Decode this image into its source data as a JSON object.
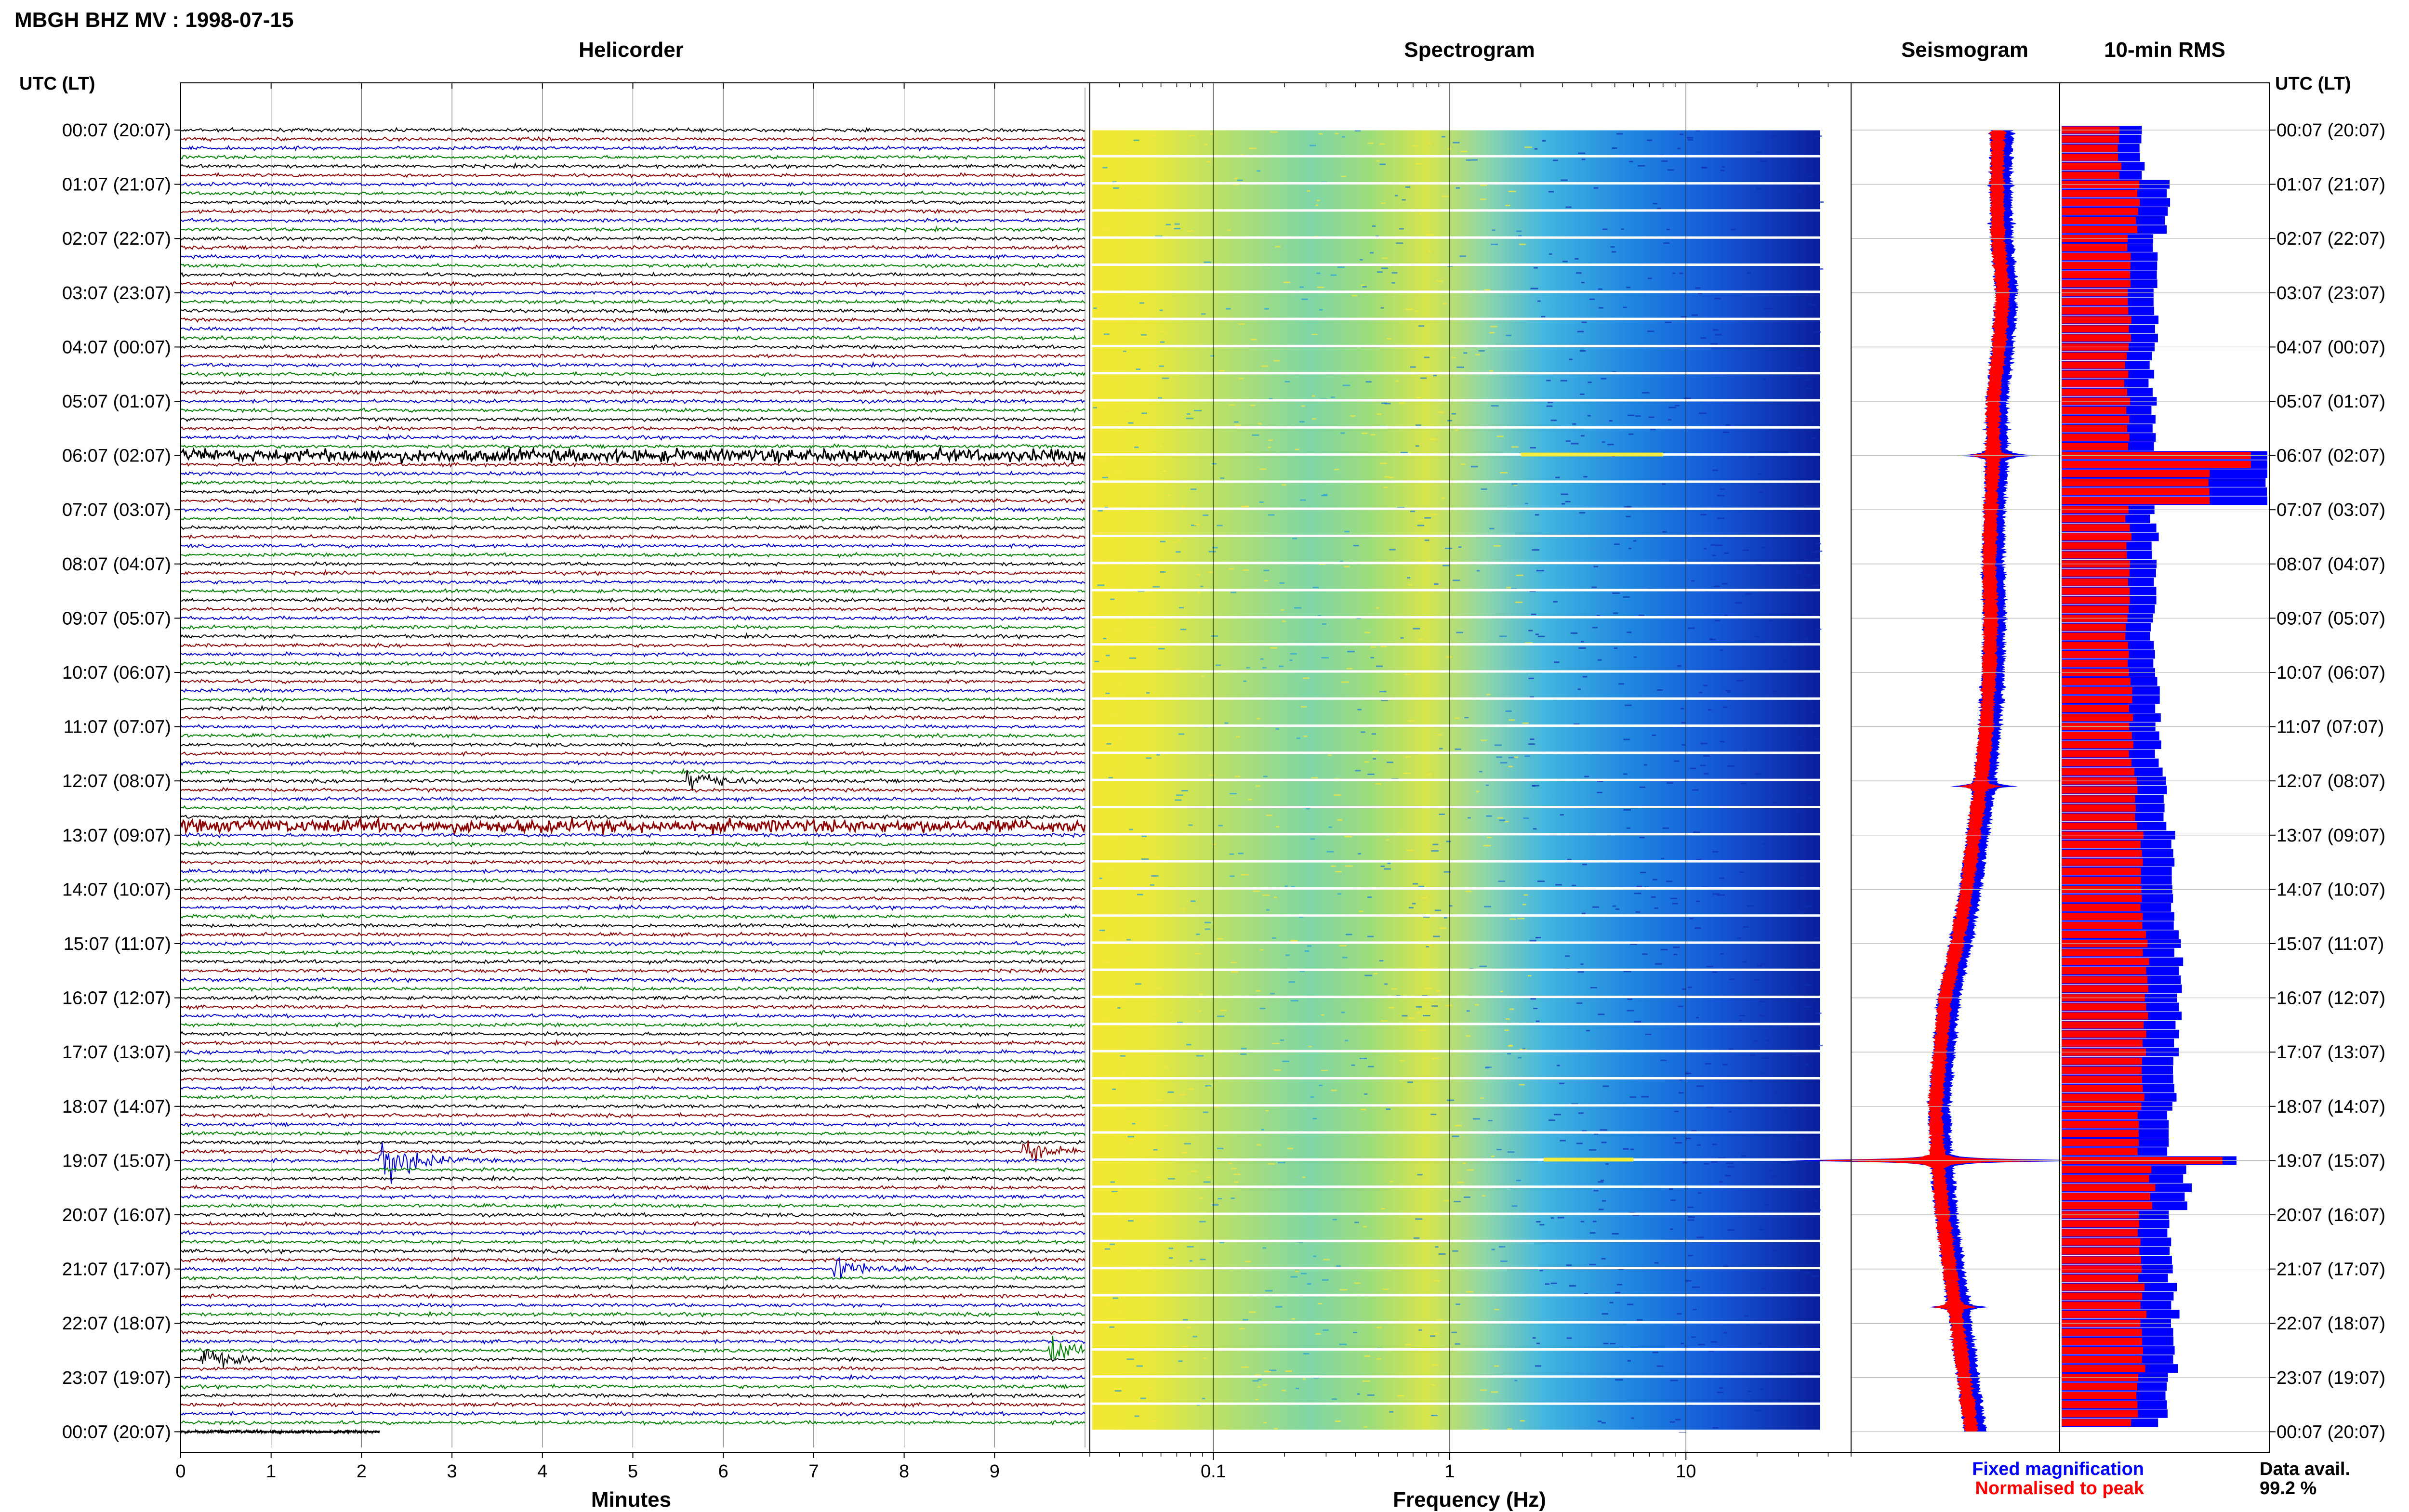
{
  "header": {
    "title": "MBGH BHZ MV : 1998-07-15"
  },
  "colors": {
    "trace_cycle": [
      "#000000",
      "#8b0000",
      "#0000cd",
      "#008000"
    ],
    "fixed_magnification": "#0000ff",
    "normalised_to_peak": "#ff0000",
    "background": "#ffffff"
  },
  "row_labels_heading": "UTC (LT)",
  "row_labels": [
    "00:07 (20:07)",
    "01:07 (21:07)",
    "02:07 (22:07)",
    "03:07 (23:07)",
    "04:07 (00:07)",
    "05:07 (01:07)",
    "06:07 (02:07)",
    "07:07 (03:07)",
    "08:07 (04:07)",
    "09:07 (05:07)",
    "10:07 (06:07)",
    "11:07 (07:07)",
    "12:07 (08:07)",
    "13:07 (09:07)",
    "14:07 (10:07)",
    "15:07 (11:07)",
    "16:07 (12:07)",
    "17:07 (13:07)",
    "18:07 (14:07)",
    "19:07 (15:07)",
    "20:07 (16:07)",
    "21:07 (17:07)",
    "22:07 (18:07)",
    "23:07 (19:07)",
    "00:07 (20:07)"
  ],
  "chart_data": [
    {
      "type": "line",
      "title": "Helicorder",
      "xlabel": "Minutes",
      "xticks": [
        "0",
        "1",
        "2",
        "3",
        "4",
        "5",
        "6",
        "7",
        "8",
        "9"
      ],
      "xlim": [
        0,
        10
      ],
      "traces_per_hour": 6,
      "trace_minutes": 10,
      "events": [
        {
          "time": "06:07-06:20",
          "minute_range": [
            0,
            10
          ],
          "note": "continuous high-amplitude tremor across 2 lines"
        },
        {
          "time": "12:57",
          "minute_range": [
            0,
            10
          ],
          "note": "elevated amplitude line"
        },
        {
          "time": "19:07",
          "minute": 2.3,
          "note": "largest event"
        },
        {
          "time": "18:57",
          "minute": 9.4
        },
        {
          "time": "21:07",
          "minute": 7.3
        },
        {
          "time": "22:47",
          "minute": 0.3
        },
        {
          "time": "22:37",
          "minute": 9.7
        },
        {
          "time": "12:07",
          "minute": 5.7
        }
      ]
    },
    {
      "type": "heatmap",
      "title": "Spectrogram",
      "xlabel": "Frequency (Hz)",
      "xscale": "log",
      "xticks": [
        "0.1",
        "1",
        "10"
      ],
      "xlim": [
        0.03,
        50
      ],
      "colormap": "jet (yellow low freq, blue high freq)"
    },
    {
      "type": "line",
      "title": "Seismogram",
      "series": [
        {
          "name": "Fixed magnification",
          "color": "#0000ff"
        },
        {
          "name": "Normalised to peak",
          "color": "#ff0000"
        }
      ],
      "spikes": [
        "06:07",
        "12:17",
        "19:07",
        "21:47"
      ]
    },
    {
      "type": "bar",
      "title": "10-min RMS",
      "series": [
        {
          "name": "Fixed magnification",
          "color": "#0000ff"
        },
        {
          "name": "Normalised to peak",
          "color": "#ff0000"
        }
      ],
      "relative_values_by_hour": [
        0.4,
        0.52,
        0.45,
        0.46,
        0.44,
        0.44,
        1.0,
        0.45,
        0.46,
        0.45,
        0.46,
        0.47,
        0.5,
        0.54,
        0.55,
        0.58,
        0.56,
        0.55,
        0.52,
        0.62,
        0.53,
        0.54,
        0.55,
        0.5
      ],
      "peaks": [
        {
          "time": "06:07",
          "value": 1.0
        },
        {
          "time": "19:07",
          "value": 0.85
        }
      ]
    }
  ],
  "legend": {
    "fixed_magnification": "Fixed magnification",
    "normalised_to_peak": "Normalised to peak"
  },
  "data_availability": {
    "label": "Data avail.",
    "value": "99.2 %"
  }
}
